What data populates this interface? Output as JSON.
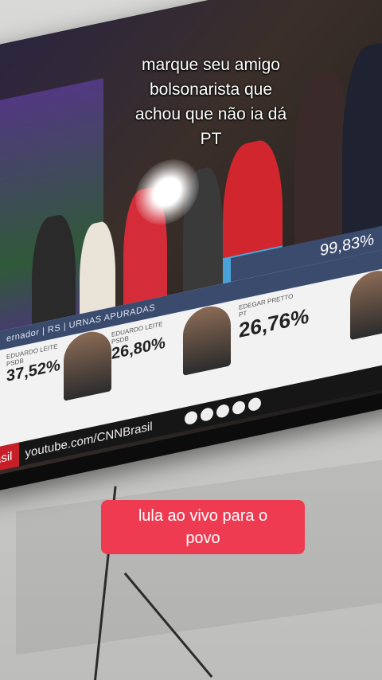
{
  "overlay_top": "marque seu amigo\nbolsonarista que\nachou que não ia dá\nPT",
  "overlay_bottom": "lula ao vivo para o\npovo",
  "tv": {
    "percent_apurado": "99,83%",
    "strip_label": "ernador | RS | URNAS APURADAS",
    "candidates": [
      {
        "name": "EDUARDO LEITE",
        "party": "PSDB",
        "pct": "37,52%"
      },
      {
        "name": "EDUARDO LEITE",
        "party": "PSDB",
        "pct": "26,80%"
      },
      {
        "name": "EDEGAR PRETTO",
        "party": "PT",
        "pct": "26,76%"
      }
    ],
    "ticker_left": "rasil",
    "ticker_url": "youtube.com/CNNBrasil"
  }
}
